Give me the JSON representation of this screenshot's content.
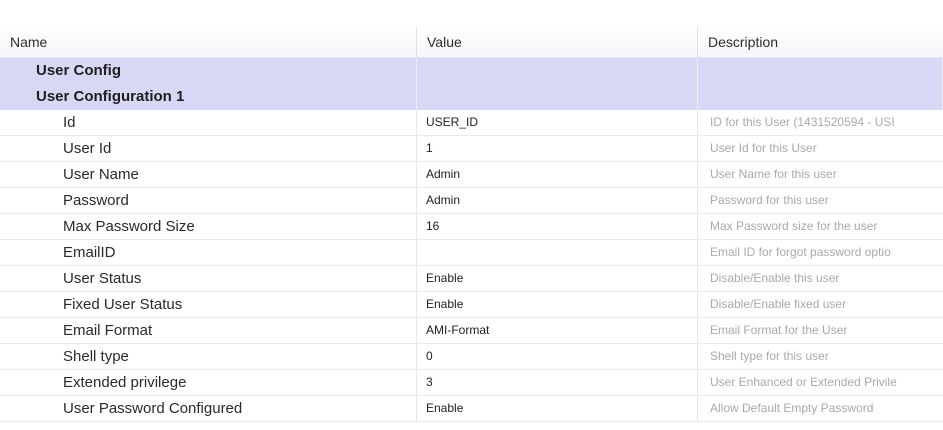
{
  "columns": {
    "name": "Name",
    "value": "Value",
    "description": "Description"
  },
  "groups": [
    {
      "label": "User Config"
    },
    {
      "label": "User Configuration 1"
    }
  ],
  "properties": [
    {
      "name": "Id",
      "value": "USER_ID",
      "description": "ID for this User (1431520594 - USI"
    },
    {
      "name": "User Id",
      "value": "1",
      "description": "User Id for this User"
    },
    {
      "name": "User Name",
      "value": "Admin",
      "description": "User Name for this user"
    },
    {
      "name": "Password",
      "value": "Admin",
      "description": "Password for this user"
    },
    {
      "name": "Max Password Size",
      "value": "16",
      "description": "Max Password size for the user"
    },
    {
      "name": "EmailID",
      "value": "",
      "description": "Email ID for forgot password optio"
    },
    {
      "name": "User Status",
      "value": "Enable",
      "description": "Disable/Enable this user"
    },
    {
      "name": "Fixed User Status",
      "value": "Enable",
      "description": "Disable/Enable fixed user"
    },
    {
      "name": "Email Format",
      "value": "AMI-Format",
      "description": "Email Format for the User"
    },
    {
      "name": "Shell type",
      "value": "0",
      "description": "Shell type for this user"
    },
    {
      "name": "Extended privilege",
      "value": "3",
      "description": "User Enhanced or Extended Privile"
    },
    {
      "name": "User Password Configured",
      "value": "Enable",
      "description": "Allow Default Empty Password"
    }
  ],
  "colors": {
    "group_row_bg": "#d8d8f6",
    "description_text": "#a9a9a9"
  }
}
